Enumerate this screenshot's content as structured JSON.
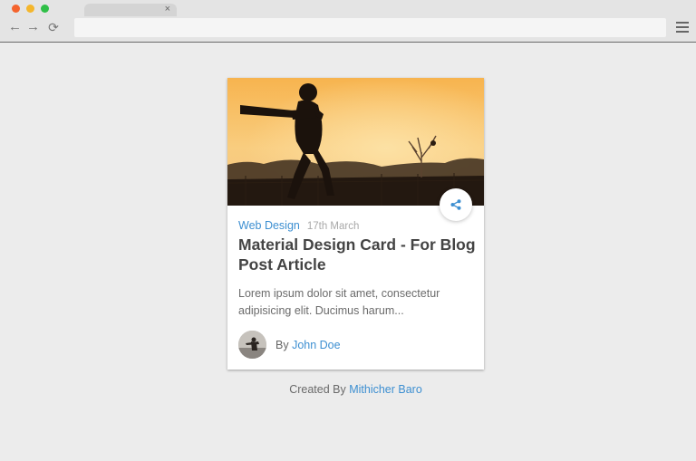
{
  "browser": {
    "tab_close": "×",
    "nav_back": "←",
    "nav_forward": "→",
    "nav_reload": "⟳",
    "address_value": ""
  },
  "card": {
    "category": "Web Design",
    "date": "17th March",
    "title": "Material Design Card - For Blog Post Article",
    "excerpt": "Lorem ipsum dolor sit amet, consectetur adipisicing elit. Ducimus harum...",
    "author_prefix": "By",
    "author_name": "John Doe"
  },
  "footer": {
    "prefix": "Created By",
    "creator": "Mithicher Baro"
  },
  "colors": {
    "link": "#3d8fd1",
    "title": "#444444",
    "body_text": "#6b6b6b",
    "background": "#ececec"
  },
  "icons": {
    "share": "share-icon",
    "menu": "hamburger-menu-icon"
  }
}
